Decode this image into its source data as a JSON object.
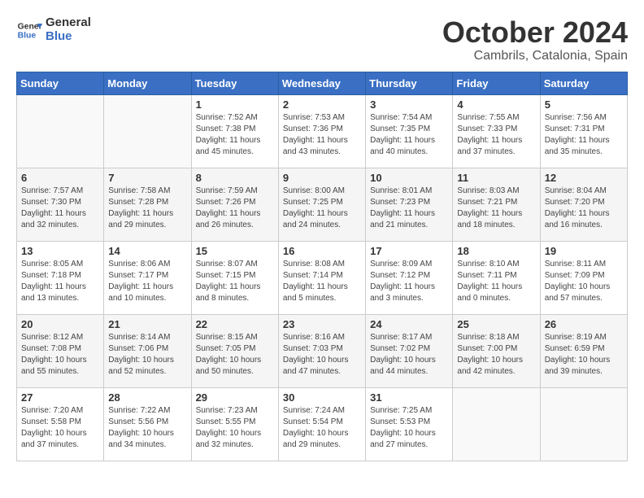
{
  "header": {
    "logo_line1": "General",
    "logo_line2": "Blue",
    "month_title": "October 2024",
    "location": "Cambrils, Catalonia, Spain"
  },
  "days_of_week": [
    "Sunday",
    "Monday",
    "Tuesday",
    "Wednesday",
    "Thursday",
    "Friday",
    "Saturday"
  ],
  "weeks": [
    [
      {
        "day": "",
        "info": ""
      },
      {
        "day": "",
        "info": ""
      },
      {
        "day": "1",
        "info": "Sunrise: 7:52 AM\nSunset: 7:38 PM\nDaylight: 11 hours and 45 minutes."
      },
      {
        "day": "2",
        "info": "Sunrise: 7:53 AM\nSunset: 7:36 PM\nDaylight: 11 hours and 43 minutes."
      },
      {
        "day": "3",
        "info": "Sunrise: 7:54 AM\nSunset: 7:35 PM\nDaylight: 11 hours and 40 minutes."
      },
      {
        "day": "4",
        "info": "Sunrise: 7:55 AM\nSunset: 7:33 PM\nDaylight: 11 hours and 37 minutes."
      },
      {
        "day": "5",
        "info": "Sunrise: 7:56 AM\nSunset: 7:31 PM\nDaylight: 11 hours and 35 minutes."
      }
    ],
    [
      {
        "day": "6",
        "info": "Sunrise: 7:57 AM\nSunset: 7:30 PM\nDaylight: 11 hours and 32 minutes."
      },
      {
        "day": "7",
        "info": "Sunrise: 7:58 AM\nSunset: 7:28 PM\nDaylight: 11 hours and 29 minutes."
      },
      {
        "day": "8",
        "info": "Sunrise: 7:59 AM\nSunset: 7:26 PM\nDaylight: 11 hours and 26 minutes."
      },
      {
        "day": "9",
        "info": "Sunrise: 8:00 AM\nSunset: 7:25 PM\nDaylight: 11 hours and 24 minutes."
      },
      {
        "day": "10",
        "info": "Sunrise: 8:01 AM\nSunset: 7:23 PM\nDaylight: 11 hours and 21 minutes."
      },
      {
        "day": "11",
        "info": "Sunrise: 8:03 AM\nSunset: 7:21 PM\nDaylight: 11 hours and 18 minutes."
      },
      {
        "day": "12",
        "info": "Sunrise: 8:04 AM\nSunset: 7:20 PM\nDaylight: 11 hours and 16 minutes."
      }
    ],
    [
      {
        "day": "13",
        "info": "Sunrise: 8:05 AM\nSunset: 7:18 PM\nDaylight: 11 hours and 13 minutes."
      },
      {
        "day": "14",
        "info": "Sunrise: 8:06 AM\nSunset: 7:17 PM\nDaylight: 11 hours and 10 minutes."
      },
      {
        "day": "15",
        "info": "Sunrise: 8:07 AM\nSunset: 7:15 PM\nDaylight: 11 hours and 8 minutes."
      },
      {
        "day": "16",
        "info": "Sunrise: 8:08 AM\nSunset: 7:14 PM\nDaylight: 11 hours and 5 minutes."
      },
      {
        "day": "17",
        "info": "Sunrise: 8:09 AM\nSunset: 7:12 PM\nDaylight: 11 hours and 3 minutes."
      },
      {
        "day": "18",
        "info": "Sunrise: 8:10 AM\nSunset: 7:11 PM\nDaylight: 11 hours and 0 minutes."
      },
      {
        "day": "19",
        "info": "Sunrise: 8:11 AM\nSunset: 7:09 PM\nDaylight: 10 hours and 57 minutes."
      }
    ],
    [
      {
        "day": "20",
        "info": "Sunrise: 8:12 AM\nSunset: 7:08 PM\nDaylight: 10 hours and 55 minutes."
      },
      {
        "day": "21",
        "info": "Sunrise: 8:14 AM\nSunset: 7:06 PM\nDaylight: 10 hours and 52 minutes."
      },
      {
        "day": "22",
        "info": "Sunrise: 8:15 AM\nSunset: 7:05 PM\nDaylight: 10 hours and 50 minutes."
      },
      {
        "day": "23",
        "info": "Sunrise: 8:16 AM\nSunset: 7:03 PM\nDaylight: 10 hours and 47 minutes."
      },
      {
        "day": "24",
        "info": "Sunrise: 8:17 AM\nSunset: 7:02 PM\nDaylight: 10 hours and 44 minutes."
      },
      {
        "day": "25",
        "info": "Sunrise: 8:18 AM\nSunset: 7:00 PM\nDaylight: 10 hours and 42 minutes."
      },
      {
        "day": "26",
        "info": "Sunrise: 8:19 AM\nSunset: 6:59 PM\nDaylight: 10 hours and 39 minutes."
      }
    ],
    [
      {
        "day": "27",
        "info": "Sunrise: 7:20 AM\nSunset: 5:58 PM\nDaylight: 10 hours and 37 minutes."
      },
      {
        "day": "28",
        "info": "Sunrise: 7:22 AM\nSunset: 5:56 PM\nDaylight: 10 hours and 34 minutes."
      },
      {
        "day": "29",
        "info": "Sunrise: 7:23 AM\nSunset: 5:55 PM\nDaylight: 10 hours and 32 minutes."
      },
      {
        "day": "30",
        "info": "Sunrise: 7:24 AM\nSunset: 5:54 PM\nDaylight: 10 hours and 29 minutes."
      },
      {
        "day": "31",
        "info": "Sunrise: 7:25 AM\nSunset: 5:53 PM\nDaylight: 10 hours and 27 minutes."
      },
      {
        "day": "",
        "info": ""
      },
      {
        "day": "",
        "info": ""
      }
    ]
  ]
}
